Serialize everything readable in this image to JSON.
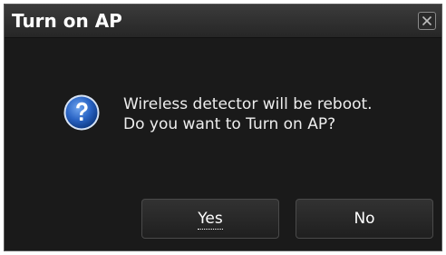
{
  "dialog": {
    "title": "Turn on AP",
    "close_icon": "close-icon",
    "message_icon": "question-icon",
    "message_line1": "Wireless detector will be reboot.",
    "message_line2": "Do you want to Turn on AP?",
    "buttons": {
      "yes_label": "Yes",
      "no_label": "No"
    }
  },
  "colors": {
    "background": "#1a1a1a",
    "titlebar": "#2f2f2f",
    "text": "#ededed",
    "icon_blue": "#2a64c4"
  }
}
